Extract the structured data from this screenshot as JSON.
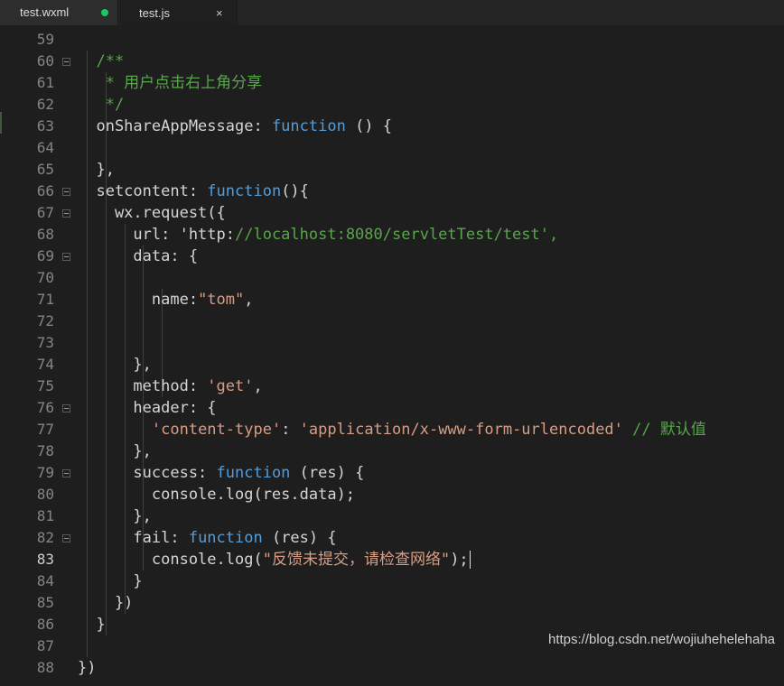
{
  "tabs": [
    {
      "label": "test.wxml",
      "modified": true
    },
    {
      "label": "test.js",
      "close_icon": "×"
    }
  ],
  "watermark": "https://blog.csdn.net/wojiuhehelehaha",
  "lines": [
    {
      "num": "59",
      "code": ""
    },
    {
      "num": "60",
      "fold": true,
      "code": "  /**"
    },
    {
      "num": "61",
      "code": "   * 用户点击右上角分享"
    },
    {
      "num": "62",
      "code": "   */"
    },
    {
      "num": "63",
      "code": "  onShareAppMessage: function () {"
    },
    {
      "num": "64",
      "code": ""
    },
    {
      "num": "65",
      "code": "  },"
    },
    {
      "num": "66",
      "fold": true,
      "code": "  setcontent: function(){"
    },
    {
      "num": "67",
      "fold": true,
      "code": "    wx.request({"
    },
    {
      "num": "68",
      "code": "      url: 'http://localhost:8080/servletTest/test',"
    },
    {
      "num": "69",
      "fold": true,
      "code": "      data: {"
    },
    {
      "num": "70",
      "code": ""
    },
    {
      "num": "71",
      "code": "        name:\"tom\","
    },
    {
      "num": "72",
      "code": ""
    },
    {
      "num": "73",
      "code": ""
    },
    {
      "num": "74",
      "code": "      },"
    },
    {
      "num": "75",
      "code": "      method: 'get',"
    },
    {
      "num": "76",
      "fold": true,
      "code": "      header: {"
    },
    {
      "num": "77",
      "code": "        'content-type': 'application/x-www-form-urlencoded' // 默认值"
    },
    {
      "num": "78",
      "code": "      },"
    },
    {
      "num": "79",
      "fold": true,
      "code": "      success: function (res) {"
    },
    {
      "num": "80",
      "code": "        console.log(res.data);"
    },
    {
      "num": "81",
      "code": "      },"
    },
    {
      "num": "82",
      "fold": true,
      "code": "      fail: function (res) {"
    },
    {
      "num": "83",
      "current": true,
      "code": "        console.log(\"反馈未提交，请检查网络\");"
    },
    {
      "num": "84",
      "code": "      }"
    },
    {
      "num": "85",
      "code": "    })"
    },
    {
      "num": "86",
      "code": "  }"
    },
    {
      "num": "87",
      "code": ""
    },
    {
      "num": "88",
      "code": "})"
    }
  ]
}
